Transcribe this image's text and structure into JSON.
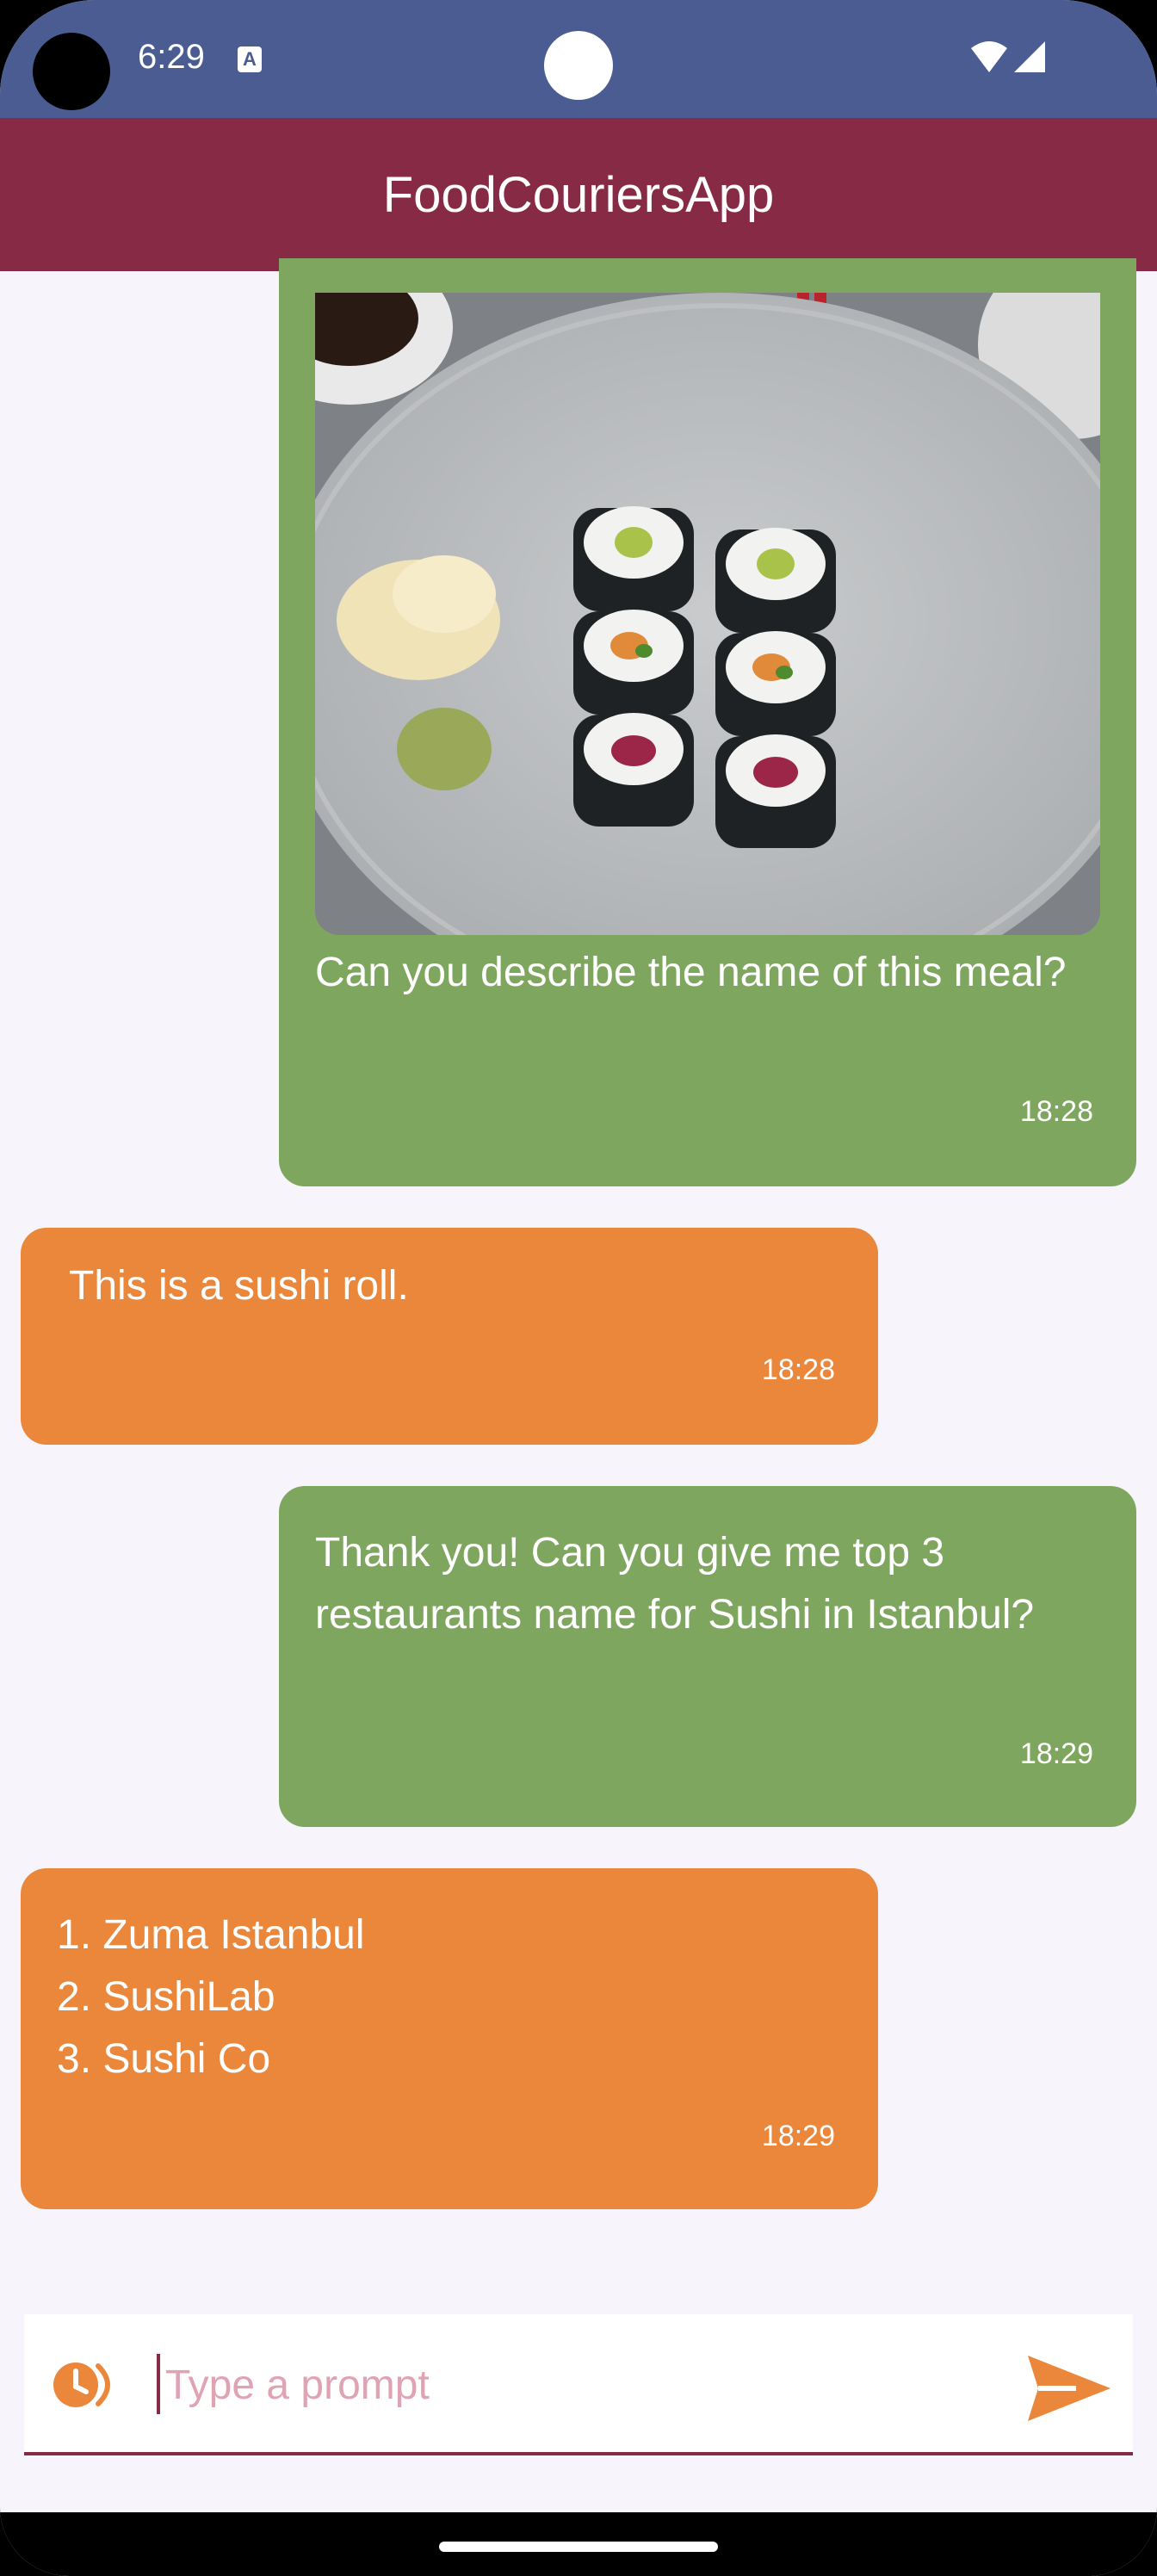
{
  "status_bar": {
    "time": "6:29",
    "notification_icon": "a-letter-icon",
    "wifi_icon": "wifi-icon",
    "signal_icon": "signal-icon"
  },
  "app_bar": {
    "title": "FoodCouriersApp"
  },
  "messages": [
    {
      "sender": "user",
      "image": "sushi-roll-photo",
      "text": "Can you describe the name of this meal?",
      "time": "18:28"
    },
    {
      "sender": "bot",
      "text": "This is a sushi roll.",
      "time": "18:28"
    },
    {
      "sender": "user",
      "text": "Thank you! Can you give me top 3 restaurants name for Sushi in Istanbul?",
      "time": "18:29"
    },
    {
      "sender": "bot",
      "text": "1. Zuma Istanbul\n2. SushiLab\n3. Sushi Co",
      "time": "18:29"
    }
  ],
  "input": {
    "placeholder": "Type a prompt",
    "value": "",
    "history_icon": "history-icon",
    "send_icon": "send-icon"
  },
  "colors": {
    "status_bar": "#4a5c92",
    "app_bar": "#862a45",
    "user_bubble": "#7fa65e",
    "bot_bubble": "#ea873b",
    "background": "#f7f5fb"
  }
}
